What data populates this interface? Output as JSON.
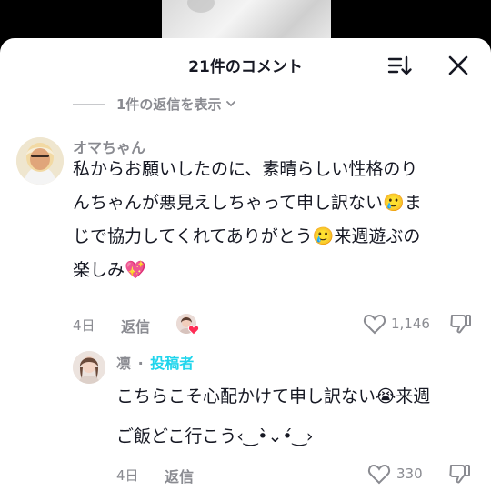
{
  "header": {
    "title": "21件のコメント"
  },
  "replies_toggle": {
    "label": "1件の返信を表示"
  },
  "comment": {
    "username": "オマちゃん",
    "lines": [
      "私からお願いしたのに、素晴らしい性格のり",
      "んちゃんが悪見えしちゃって申し訳ない🥲ま",
      "じで協力してくれてありがとう🥲来週遊ぶの",
      "楽しみ💖"
    ],
    "age": "4日",
    "reply_label": "返信",
    "like_count": "1,146"
  },
  "reply": {
    "username": "凛",
    "separator": "·",
    "author_badge": "投稿者",
    "lines": [
      "こちらこそ心配かけて申し訳ない😭来週",
      "ご飯どこ行こう‹‿•̀⌄•́‿›"
    ],
    "age": "4日",
    "reply_label": "返信",
    "like_count": "330"
  },
  "colors": {
    "accent": "#20d5ec",
    "text": "#161823",
    "muted": "#8a8b91",
    "heart": "#fe2c55"
  }
}
